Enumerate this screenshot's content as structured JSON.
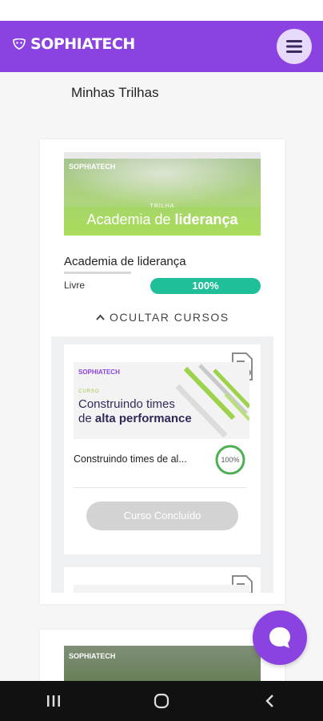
{
  "app": {
    "brand": "SOPHIATECH",
    "page_title": "Minhas Trilhas"
  },
  "trail": {
    "banner_logo": "SOPHIATECH",
    "banner_kicker": "TRILHA",
    "banner_title_regular": "Academia de ",
    "banner_title_bold": "liderança",
    "name": "Academia de liderança",
    "access": "Livre",
    "progress": "100%",
    "progress_value": 1.0,
    "toggle_label": "OCULTAR CURSOS"
  },
  "course": {
    "image_logo": "SOPHIATECH",
    "image_kicker": "CURSO",
    "image_title_line1": "Construindo times",
    "image_title_line2_regular": "de ",
    "image_title_line2_bold": "alta performance",
    "name": "Construindo times de al...",
    "progress": "100%",
    "progress_value": 1.0,
    "status_button": "Curso Concluído"
  },
  "second_trail": {
    "banner_logo": "SOPHIATECH"
  },
  "icons": {
    "menu": "hamburger-icon",
    "chat": "chat-bubble-icon",
    "certificate": "certificate-icon",
    "chevron": "chevron-up-icon",
    "nav_recent": "recent-apps-icon",
    "nav_home": "home-icon",
    "nav_back": "back-icon"
  },
  "colors": {
    "brand": "#8a43e0",
    "progress": "#1fbf9a",
    "ring": "#4caf50",
    "disabled_button": "#d3d3d3"
  }
}
